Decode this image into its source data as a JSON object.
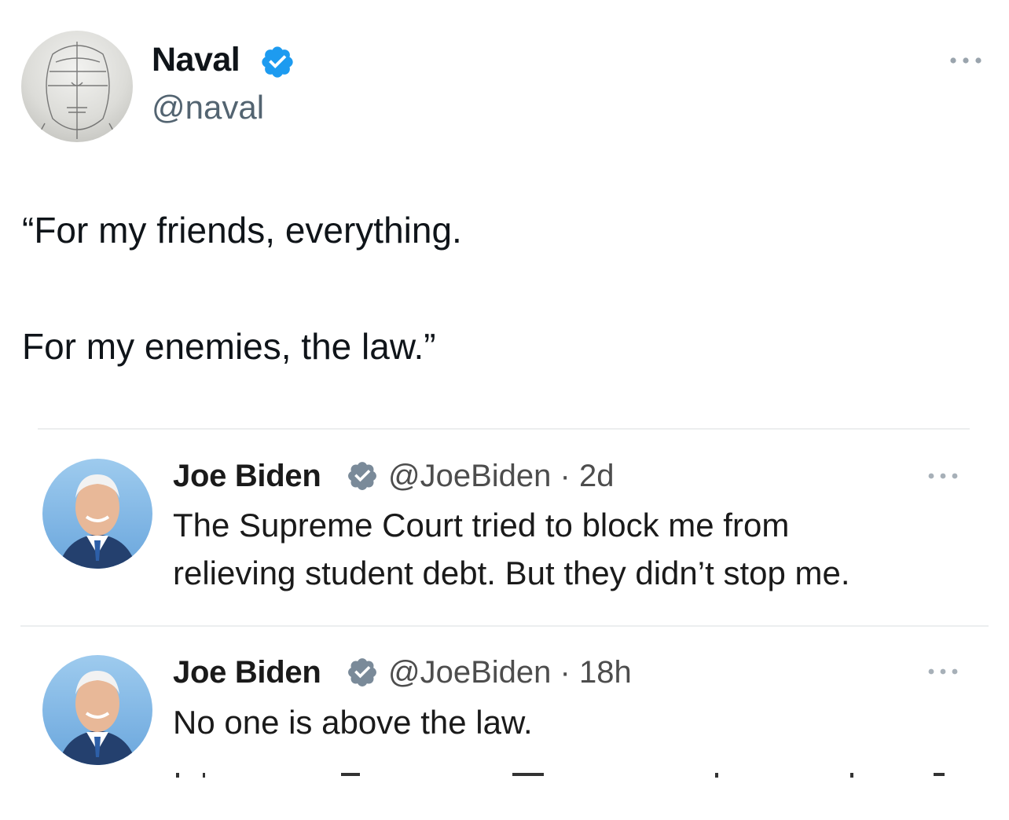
{
  "tweet": {
    "author_name": "Naval",
    "author_handle": "@naval",
    "author_verified": true,
    "lines": [
      "“For my friends, everything.",
      "For my enemies, the law.”"
    ]
  },
  "embedded_posts": [
    {
      "author_name": "Joe Biden",
      "author_handle": "@JoeBiden",
      "time": "2d",
      "meta": "@JoeBiden · 2d",
      "verified": true,
      "text_lines": [
        "The Supreme Court tried to block me from",
        "relieving student debt. But they didn’t stop me."
      ]
    },
    {
      "author_name": "Joe Biden",
      "author_handle": "@JoeBiden",
      "time": "18h",
      "meta": "@JoeBiden · 18h",
      "verified": true,
      "text_lines": [
        "No one is above the law."
      ]
    }
  ],
  "colors": {
    "verified_blue": "#1d9bf0",
    "verified_gray": "#7a8a99",
    "text_primary": "#0f1419",
    "text_secondary": "#536471"
  },
  "icons": {
    "verified": "verified-badge-icon",
    "more": "more-options-icon"
  }
}
